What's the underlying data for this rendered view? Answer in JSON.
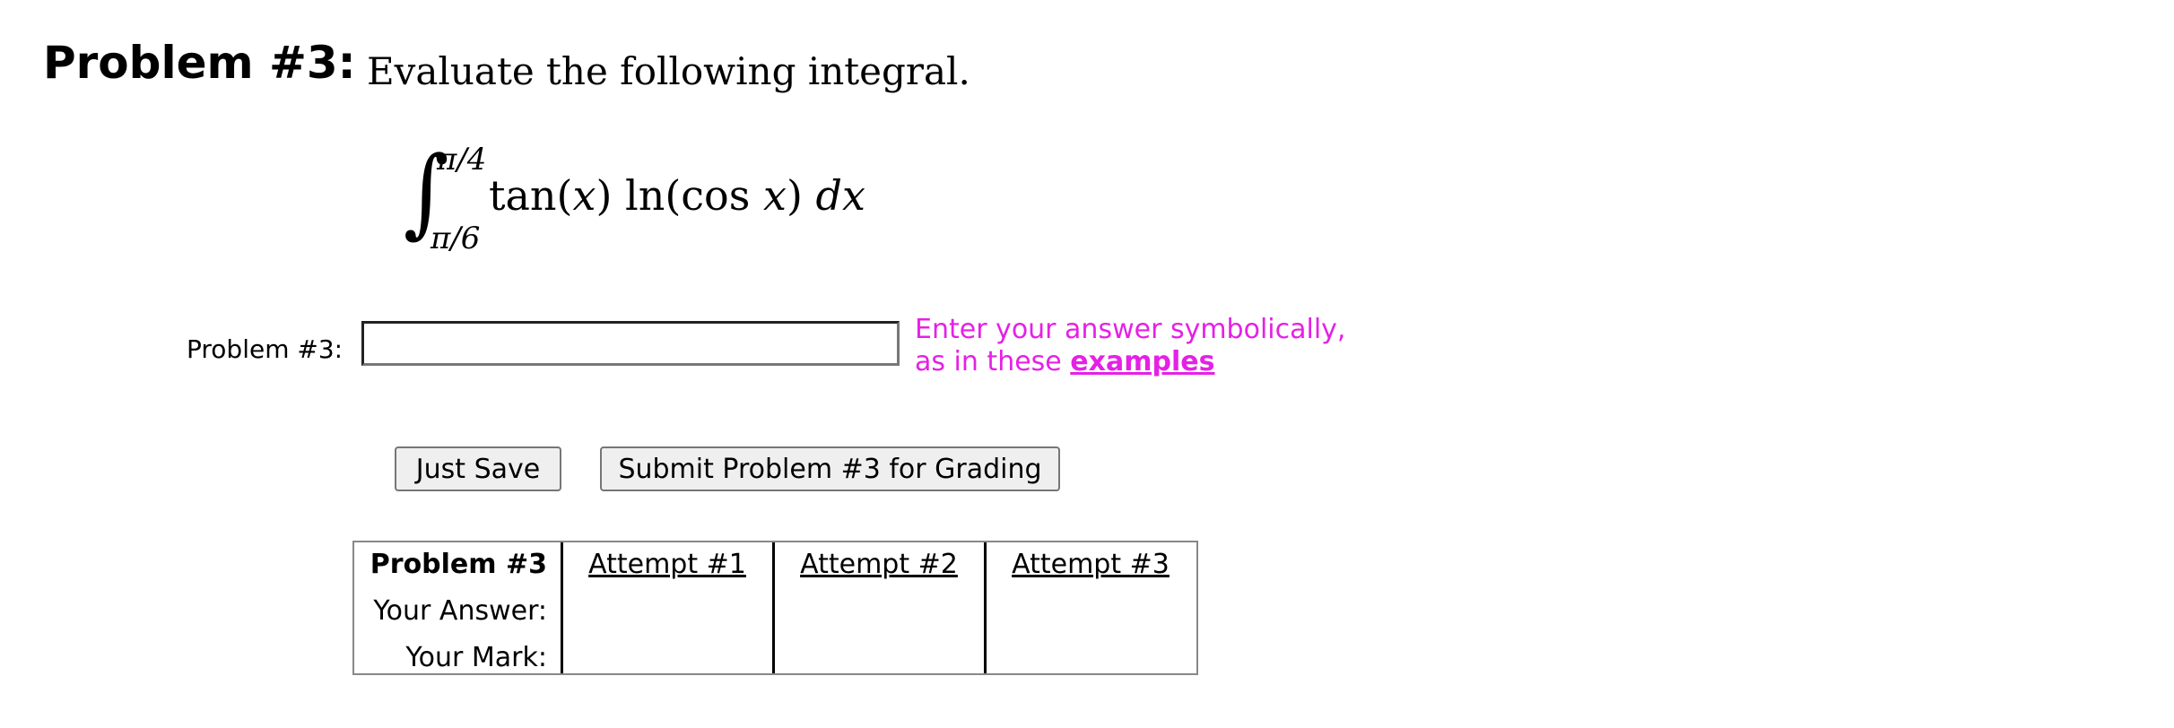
{
  "problem": {
    "heading": "Problem #3:",
    "statement": "Evaluate the following integral."
  },
  "formula": {
    "integral_sign": "∫",
    "upper_limit": "π/4",
    "lower_limit": "π/6",
    "func_tan": "tan(",
    "var_x1": "x",
    "func_ln": ") ln(cos ",
    "var_x2": "x",
    "close": ") ",
    "differential": "dx"
  },
  "answer": {
    "label": "Problem #3:",
    "value": "",
    "placeholder": "",
    "hint_line1": "Enter your answer symbolically,",
    "hint_line2_prefix": "as in these ",
    "hint_link": "examples"
  },
  "buttons": {
    "just_save": "Just Save",
    "submit": "Submit Problem #3 for Grading"
  },
  "attempts_table": {
    "header_label": "Problem #3",
    "columns": [
      "Attempt #1",
      "Attempt #2",
      "Attempt #3"
    ],
    "row_labels": [
      "Your Answer:",
      "Your Mark:"
    ],
    "answers": [
      "",
      "",
      ""
    ],
    "marks": [
      "",
      "",
      ""
    ]
  },
  "colors": {
    "hint": "#e521e5"
  }
}
